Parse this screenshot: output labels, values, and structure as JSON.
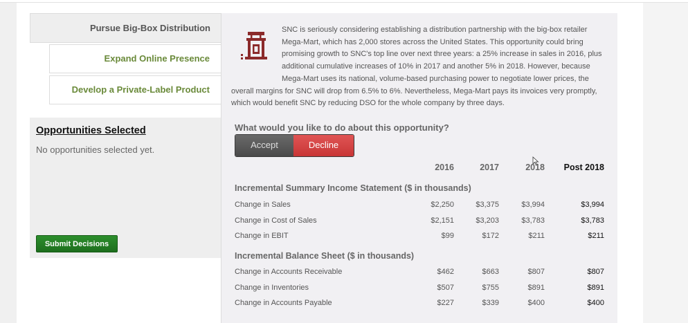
{
  "tabs": [
    {
      "label": "Pursue Big-Box Distribution",
      "active": true
    },
    {
      "label": "Expand Online Presence",
      "active": false
    },
    {
      "label": "Develop a Private-Label Product",
      "active": false
    }
  ],
  "selected": {
    "title": "Opportunities Selected",
    "empty_text": "No opportunities selected yet.",
    "submit_label": "Submit Decisions"
  },
  "opportunity": {
    "icon": "storefront-logo-icon",
    "description": "SNC is seriously considering establishing a distribution partnership with the big-box retailer Mega-Mart, which has 2,000 stores across the United States. This opportunity could bring promising growth to SNC's top line over next three years: a 25% increase in sales in 2016, plus additional cumulative increases of 10% in 2017 and another 5% in 2018. However, because Mega-Mart uses its national, volume-based purchasing power to negotiate lower prices, the overall margins for SNC will drop from 6.5% to 6%. Nevertheless, Mega-Mart pays its invoices very promptly, which would benefit SNC by reducing DSO for the whole company by three days.",
    "question": "What would you like to do about this opportunity?",
    "accept_label": "Accept",
    "decline_label": "Decline"
  },
  "table": {
    "columns": [
      "2016",
      "2017",
      "2018",
      "Post 2018"
    ],
    "income_title": "Incremental Summary Income Statement ($ in thousands)",
    "income_rows": [
      {
        "label": "Change in Sales",
        "values": [
          "$2,250",
          "$3,375",
          "$3,994",
          "$3,994"
        ]
      },
      {
        "label": "Change in Cost of Sales",
        "values": [
          "$2,151",
          "$3,203",
          "$3,783",
          "$3,783"
        ]
      },
      {
        "label": "Change in EBIT",
        "values": [
          "$99",
          "$172",
          "$211",
          "$211"
        ]
      }
    ],
    "balance_title": "Incremental Balance Sheet ($ in thousands)",
    "balance_rows": [
      {
        "label": "Change in Accounts Receivable",
        "values": [
          "$462",
          "$663",
          "$807",
          "$807"
        ]
      },
      {
        "label": "Change in Inventories",
        "values": [
          "$507",
          "$755",
          "$891",
          "$891"
        ]
      },
      {
        "label": "Change in Accounts Payable",
        "values": [
          "$227",
          "$339",
          "$400",
          "$400"
        ]
      }
    ]
  },
  "colors": {
    "accent_green": "#6a8a3a",
    "submit_green": "#1d6e1d",
    "decline_red": "#d04040",
    "logo_red": "#8b2a2a"
  }
}
